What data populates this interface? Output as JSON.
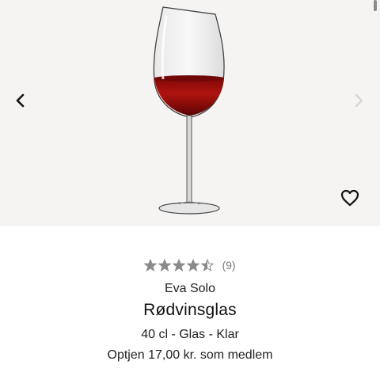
{
  "gallery": {
    "image_alt": "Rødvinsglas",
    "prev_icon": "chevron-left-icon",
    "next_icon": "chevron-right-icon",
    "favorite_icon": "heart-outline-icon"
  },
  "product": {
    "rating": 4.5,
    "rating_max": 5,
    "review_count": "(9)",
    "brand": "Eva Solo",
    "title": "Rødvinsglas",
    "variant": "40 cl - Glas - Klar",
    "loyalty": "Optjen 17,00 kr. som medlem"
  },
  "colors": {
    "gallery_bg": "#f6f4f3",
    "star_fill": "#8a8a8a",
    "wine": "#9c0d0d"
  }
}
